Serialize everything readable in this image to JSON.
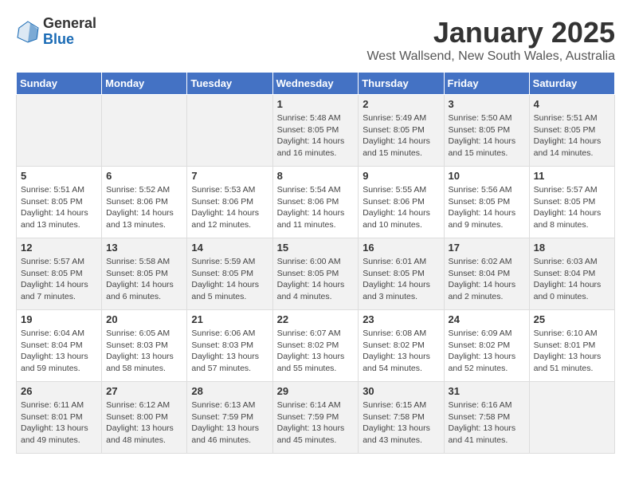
{
  "header": {
    "logo_general": "General",
    "logo_blue": "Blue",
    "main_title": "January 2025",
    "sub_title": "West Wallsend, New South Wales, Australia"
  },
  "calendar": {
    "days_of_week": [
      "Sunday",
      "Monday",
      "Tuesday",
      "Wednesday",
      "Thursday",
      "Friday",
      "Saturday"
    ],
    "weeks": [
      [
        {
          "day": "",
          "info": ""
        },
        {
          "day": "",
          "info": ""
        },
        {
          "day": "",
          "info": ""
        },
        {
          "day": "1",
          "info": "Sunrise: 5:48 AM\nSunset: 8:05 PM\nDaylight: 14 hours\nand 16 minutes."
        },
        {
          "day": "2",
          "info": "Sunrise: 5:49 AM\nSunset: 8:05 PM\nDaylight: 14 hours\nand 15 minutes."
        },
        {
          "day": "3",
          "info": "Sunrise: 5:50 AM\nSunset: 8:05 PM\nDaylight: 14 hours\nand 15 minutes."
        },
        {
          "day": "4",
          "info": "Sunrise: 5:51 AM\nSunset: 8:05 PM\nDaylight: 14 hours\nand 14 minutes."
        }
      ],
      [
        {
          "day": "5",
          "info": "Sunrise: 5:51 AM\nSunset: 8:05 PM\nDaylight: 14 hours\nand 13 minutes."
        },
        {
          "day": "6",
          "info": "Sunrise: 5:52 AM\nSunset: 8:06 PM\nDaylight: 14 hours\nand 13 minutes."
        },
        {
          "day": "7",
          "info": "Sunrise: 5:53 AM\nSunset: 8:06 PM\nDaylight: 14 hours\nand 12 minutes."
        },
        {
          "day": "8",
          "info": "Sunrise: 5:54 AM\nSunset: 8:06 PM\nDaylight: 14 hours\nand 11 minutes."
        },
        {
          "day": "9",
          "info": "Sunrise: 5:55 AM\nSunset: 8:06 PM\nDaylight: 14 hours\nand 10 minutes."
        },
        {
          "day": "10",
          "info": "Sunrise: 5:56 AM\nSunset: 8:05 PM\nDaylight: 14 hours\nand 9 minutes."
        },
        {
          "day": "11",
          "info": "Sunrise: 5:57 AM\nSunset: 8:05 PM\nDaylight: 14 hours\nand 8 minutes."
        }
      ],
      [
        {
          "day": "12",
          "info": "Sunrise: 5:57 AM\nSunset: 8:05 PM\nDaylight: 14 hours\nand 7 minutes."
        },
        {
          "day": "13",
          "info": "Sunrise: 5:58 AM\nSunset: 8:05 PM\nDaylight: 14 hours\nand 6 minutes."
        },
        {
          "day": "14",
          "info": "Sunrise: 5:59 AM\nSunset: 8:05 PM\nDaylight: 14 hours\nand 5 minutes."
        },
        {
          "day": "15",
          "info": "Sunrise: 6:00 AM\nSunset: 8:05 PM\nDaylight: 14 hours\nand 4 minutes."
        },
        {
          "day": "16",
          "info": "Sunrise: 6:01 AM\nSunset: 8:05 PM\nDaylight: 14 hours\nand 3 minutes."
        },
        {
          "day": "17",
          "info": "Sunrise: 6:02 AM\nSunset: 8:04 PM\nDaylight: 14 hours\nand 2 minutes."
        },
        {
          "day": "18",
          "info": "Sunrise: 6:03 AM\nSunset: 8:04 PM\nDaylight: 14 hours\nand 0 minutes."
        }
      ],
      [
        {
          "day": "19",
          "info": "Sunrise: 6:04 AM\nSunset: 8:04 PM\nDaylight: 13 hours\nand 59 minutes."
        },
        {
          "day": "20",
          "info": "Sunrise: 6:05 AM\nSunset: 8:03 PM\nDaylight: 13 hours\nand 58 minutes."
        },
        {
          "day": "21",
          "info": "Sunrise: 6:06 AM\nSunset: 8:03 PM\nDaylight: 13 hours\nand 57 minutes."
        },
        {
          "day": "22",
          "info": "Sunrise: 6:07 AM\nSunset: 8:02 PM\nDaylight: 13 hours\nand 55 minutes."
        },
        {
          "day": "23",
          "info": "Sunrise: 6:08 AM\nSunset: 8:02 PM\nDaylight: 13 hours\nand 54 minutes."
        },
        {
          "day": "24",
          "info": "Sunrise: 6:09 AM\nSunset: 8:02 PM\nDaylight: 13 hours\nand 52 minutes."
        },
        {
          "day": "25",
          "info": "Sunrise: 6:10 AM\nSunset: 8:01 PM\nDaylight: 13 hours\nand 51 minutes."
        }
      ],
      [
        {
          "day": "26",
          "info": "Sunrise: 6:11 AM\nSunset: 8:01 PM\nDaylight: 13 hours\nand 49 minutes."
        },
        {
          "day": "27",
          "info": "Sunrise: 6:12 AM\nSunset: 8:00 PM\nDaylight: 13 hours\nand 48 minutes."
        },
        {
          "day": "28",
          "info": "Sunrise: 6:13 AM\nSunset: 7:59 PM\nDaylight: 13 hours\nand 46 minutes."
        },
        {
          "day": "29",
          "info": "Sunrise: 6:14 AM\nSunset: 7:59 PM\nDaylight: 13 hours\nand 45 minutes."
        },
        {
          "day": "30",
          "info": "Sunrise: 6:15 AM\nSunset: 7:58 PM\nDaylight: 13 hours\nand 43 minutes."
        },
        {
          "day": "31",
          "info": "Sunrise: 6:16 AM\nSunset: 7:58 PM\nDaylight: 13 hours\nand 41 minutes."
        },
        {
          "day": "",
          "info": ""
        }
      ]
    ]
  }
}
